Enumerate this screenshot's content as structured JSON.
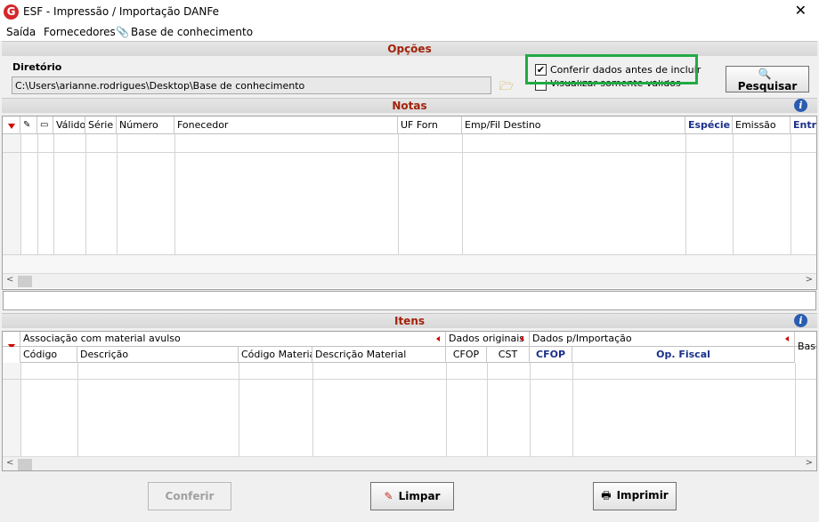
{
  "window": {
    "title": "ESF - Impressão / Importação DANFe",
    "logo_letter": "G",
    "close_glyph": "✕"
  },
  "menu": [
    {
      "label": "Saída"
    },
    {
      "label": "Fornecedores"
    },
    {
      "label": "Base de conhecimento"
    }
  ],
  "options": {
    "section_title": "Opções",
    "dir_label": "Diretório",
    "dir_value": "C:\\Users\\arianne.rodrigues\\Desktop\\Base de conhecimento",
    "check_confer": {
      "label": "Conferir dados antes de incluir",
      "checked": true,
      "mark": "✔"
    },
    "check_valid": {
      "label": "Visualizar somente válidos",
      "checked": false
    },
    "search_button": "Pesquisar"
  },
  "notas": {
    "section_title": "Notas",
    "columns": [
      "Válido",
      "Série",
      "Número",
      "Fonecedor",
      "UF Forn",
      "Emp/Fil Destino",
      "Espécie",
      "Emissão",
      "Entra"
    ]
  },
  "itens": {
    "section_title": "Itens",
    "groups": [
      "Associação com material avulso",
      "Dados originais",
      "Dados p/Importação",
      "Base"
    ],
    "columns": [
      "Código",
      "Descrição",
      "Código Material",
      "Descrição Material",
      "CFOP",
      "CST",
      "CFOP",
      "Op. Fiscal"
    ]
  },
  "buttons": {
    "confer": "Conferir",
    "clear": "Limpar",
    "print": "Imprimir"
  },
  "icons": {
    "info": "i",
    "folder": "🗁",
    "left_arrow": "<",
    "right_arrow": ">",
    "clear_icon": "✎",
    "print_icon": "🖶",
    "search_icon": "🔍",
    "attach_icon": "📎"
  },
  "colors": {
    "section_title": "#a0230a",
    "highlight": "#22aa44",
    "header_bold": "#1a2f8a",
    "sort_marker": "#d00000"
  }
}
